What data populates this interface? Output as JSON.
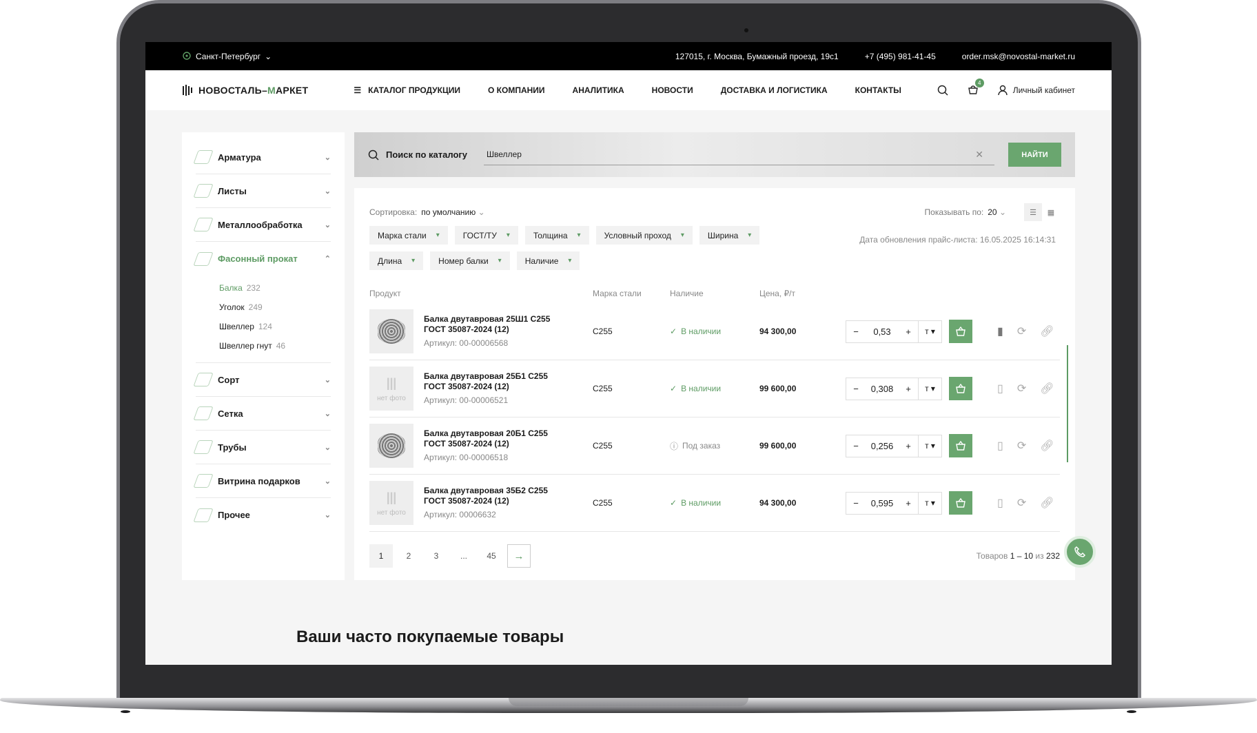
{
  "topbar": {
    "city": "Санкт-Петербург",
    "address": "127015, г. Москва, Бумажный проезд, 19с1",
    "phone": "+7 (495) 981-41-45",
    "email": "order.msk@novostal-market.ru"
  },
  "header": {
    "logo": {
      "part1": "НОВОСТАЛЬ–",
      "accent": "М",
      "part2": "АРКЕТ"
    },
    "nav": [
      "КАТАЛОГ ПРОДУКЦИИ",
      "О КОМПАНИИ",
      "АНАЛИТИКА",
      "НОВОСТИ",
      "ДОСТАВКА И ЛОГИСТИКА",
      "КОНТАКТЫ"
    ],
    "cart_count": "4",
    "cabinet": "Личный кабинет"
  },
  "sidebar": {
    "items": [
      {
        "label": "Арматура"
      },
      {
        "label": "Листы"
      },
      {
        "label": "Металлообработка"
      },
      {
        "label": "Фасонный прокат"
      },
      {
        "label": "Сорт"
      },
      {
        "label": "Сетка"
      },
      {
        "label": "Трубы"
      },
      {
        "label": "Витрина подарков"
      },
      {
        "label": "Прочее"
      }
    ],
    "subitems": [
      {
        "label": "Балка",
        "count": "232"
      },
      {
        "label": "Уголок",
        "count": "249"
      },
      {
        "label": "Швеллер",
        "count": "124"
      },
      {
        "label": "Швеллер гнут",
        "count": "46"
      }
    ]
  },
  "search": {
    "label": "Поиск по каталогу",
    "value": "Швеллер",
    "button": "НАЙТИ"
  },
  "toolbar": {
    "sort_label": "Сортировка:",
    "sort_value": "по умолчанию",
    "per_page_label": "Показывать по:",
    "per_page_value": "20",
    "price_update": "Дата обновления прайс-листа:  16.05.2025 16:14:31"
  },
  "filters": [
    "Марка стали",
    "ГОСТ/ТУ",
    "Толщина",
    "Условный проход",
    "Ширина",
    "Длина",
    "Номер балки",
    "Наличие"
  ],
  "table": {
    "headers": [
      "Продукт",
      "Марка стали",
      "Наличие",
      "Цена, ₽/т"
    ],
    "rows": [
      {
        "name1": "Балка двутавровая 25Ш1 С255",
        "name2": "ГОСТ 35087-2024 (12)",
        "article": "Артикул: 00-00006568",
        "mark": "С255",
        "avail": "В наличии",
        "price": "94 300,00",
        "qty": "0,53",
        "unit": "т"
      },
      {
        "name1": "Балка двутавровая 25Б1 С255",
        "name2": "ГОСТ 35087-2024 (12)",
        "article": "Артикул: 00-00006521",
        "mark": "С255",
        "avail": "В наличии",
        "price": "99 600,00",
        "qty": "0,308",
        "unit": "т"
      },
      {
        "name1": "Балка двутавровая 20Б1 С255",
        "name2": "ГОСТ 35087-2024 (12)",
        "article": "Артикул: 00-00006518",
        "mark": "С255",
        "avail": "Под заказ",
        "price": "99 600,00",
        "qty": "0,256",
        "unit": "т"
      },
      {
        "name1": "Балка двутавровая 35Б2 С255",
        "name2": "ГОСТ 35087-2024 (12)",
        "article": "Артикул: 00006632",
        "mark": "С255",
        "avail": "В наличии",
        "price": "94 300,00",
        "qty": "0,595",
        "unit": "т"
      }
    ],
    "no_photo": "нет фото"
  },
  "pager": {
    "pages": [
      "1",
      "2",
      "3",
      "...",
      "45"
    ],
    "total_prefix": "Товаров",
    "total_range": "1 – 10",
    "total_of": "из",
    "total_count": "232"
  },
  "section_title": "Ваши часто покупаемые товары",
  "colors": {
    "accent": "#6aa66f",
    "topbar": "#000000"
  }
}
